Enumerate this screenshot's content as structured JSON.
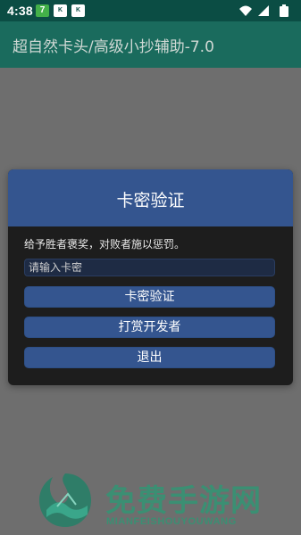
{
  "status_bar": {
    "time": "4:38",
    "icons": [
      "app-7-icon",
      "app-k-icon",
      "app-k-icon",
      "wifi-icon",
      "signal-icon",
      "battery-icon"
    ],
    "app_icon_7": "7",
    "app_icon_k": "K"
  },
  "app_bar": {
    "title": "超自然卡头/高级小抄辅助-7.0"
  },
  "dialog": {
    "title": "卡密验证",
    "message": "给予胜者褒奖，对败者施以惩罚。",
    "input": {
      "value": "",
      "placeholder": "请输入卡密"
    },
    "buttons": {
      "verify": "卡密验证",
      "tip": "打赏开发者",
      "exit": "退出"
    }
  },
  "watermark": {
    "title": "免费手游网",
    "subtitle": "MIANFEISHOUYOUWANG"
  },
  "colors": {
    "status_bar": "#0b4d44",
    "app_bar": "#1a6b5d",
    "scrim": "#6e6e6e",
    "dialog_header": "#34558f",
    "dialog_body": "#1d1d1d",
    "button": "#34558f",
    "watermark": "#3b8f73"
  }
}
